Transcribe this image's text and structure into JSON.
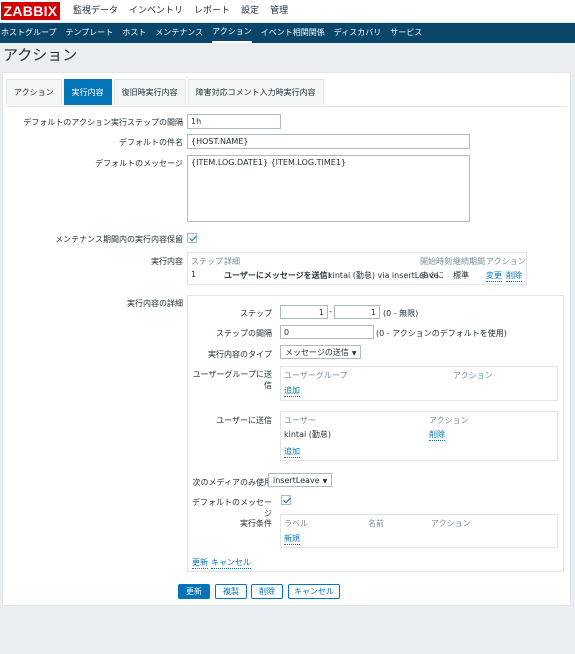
{
  "brand": "ZABBIX",
  "main_menu": [
    "監視データ",
    "インベントリ",
    "レポート",
    "設定",
    "管理"
  ],
  "sub_menu": [
    "ホストグループ",
    "テンプレート",
    "ホスト",
    "メンテナンス",
    "アクション",
    "イベント相関関係",
    "ディスカバリ",
    "サービス"
  ],
  "page_title": "アクション",
  "tabs": [
    "アクション",
    "実行内容",
    "復旧時実行内容",
    "障害対応コメント入力時実行内容"
  ],
  "form": {
    "step_duration_label": "デフォルトのアクション実行ステップの間隔",
    "step_duration_value": "1h",
    "subject_label": "デフォルトの件名",
    "subject_value": "{HOST.NAME}",
    "message_label": "デフォルトのメッセージ",
    "message_value": "{ITEM.LOG.DATE1} {ITEM.LOG.TIME1}",
    "pause_label": "メンテナンス期間内の実行内容保留",
    "operations_label": "実行内容",
    "operations_table": {
      "headers": [
        "ステップ",
        "詳細",
        "開始時刻",
        "継続期間",
        "アクション"
      ],
      "row": {
        "step": "1",
        "detail_bold": "ユーザーにメッセージを送信:",
        "detail_rest": "kintai (勤怠) via insertLeave",
        "start": "すぐに",
        "duration": "標準",
        "edit": "変更",
        "remove": "削除"
      }
    },
    "details_label": "実行内容の詳細",
    "details": {
      "step_label": "ステップ",
      "step_from": "1",
      "step_to": "1",
      "step_dash": "-",
      "step_hint": "(0 - 無限)",
      "interval_label": "ステップの間隔",
      "interval_value": "0",
      "interval_hint": "(0 - アクションのデフォルトを使用)",
      "type_label": "実行内容のタイプ",
      "type_value": "メッセージの送信",
      "groups_label": "ユーザーグループに送信",
      "groups_col1": "ユーザーグループ",
      "groups_col2": "アクション",
      "groups_add": "追加",
      "users_label": "ユーザーに送信",
      "users_col1": "ユーザー",
      "users_col2": "アクション",
      "user_name": "kintai (勤怠)",
      "user_remove": "削除",
      "users_add": "追加",
      "media_label": "次のメディアのみ使用",
      "media_value": "insertLeave",
      "default_msg_label": "デフォルトのメッセージ",
      "cond_label": "実行条件",
      "cond_col1": "ラベル",
      "cond_col2": "名前",
      "cond_col3": "アクション",
      "cond_new": "新規",
      "update_link": "更新",
      "cancel_link": "キャンセル"
    }
  },
  "buttons": {
    "update": "更新",
    "clone": "複製",
    "delete": "削除",
    "cancel": "キャンセル"
  }
}
